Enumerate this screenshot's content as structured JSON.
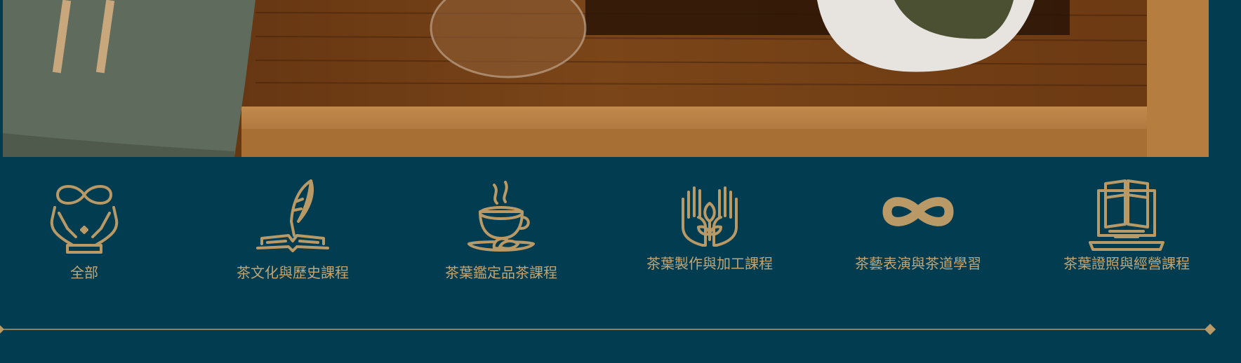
{
  "colors": {
    "background": "#013c50",
    "accent": "#b99a67",
    "label": "#c2a574"
  },
  "categories": [
    {
      "label": "全部",
      "icon": "hands-infinity-icon"
    },
    {
      "label": "茶文化與歷史課程",
      "icon": "quill-book-icon"
    },
    {
      "label": "茶葉鑑定品茶課程",
      "icon": "tea-cup-icon"
    },
    {
      "label": "茶葉製作與加工課程",
      "icon": "hands-leaf-icon"
    },
    {
      "label": "茶藝表演與茶道學習",
      "icon": "infinity-icon"
    },
    {
      "label": "茶葉證照與經營課程",
      "icon": "laptop-book-icon"
    }
  ]
}
